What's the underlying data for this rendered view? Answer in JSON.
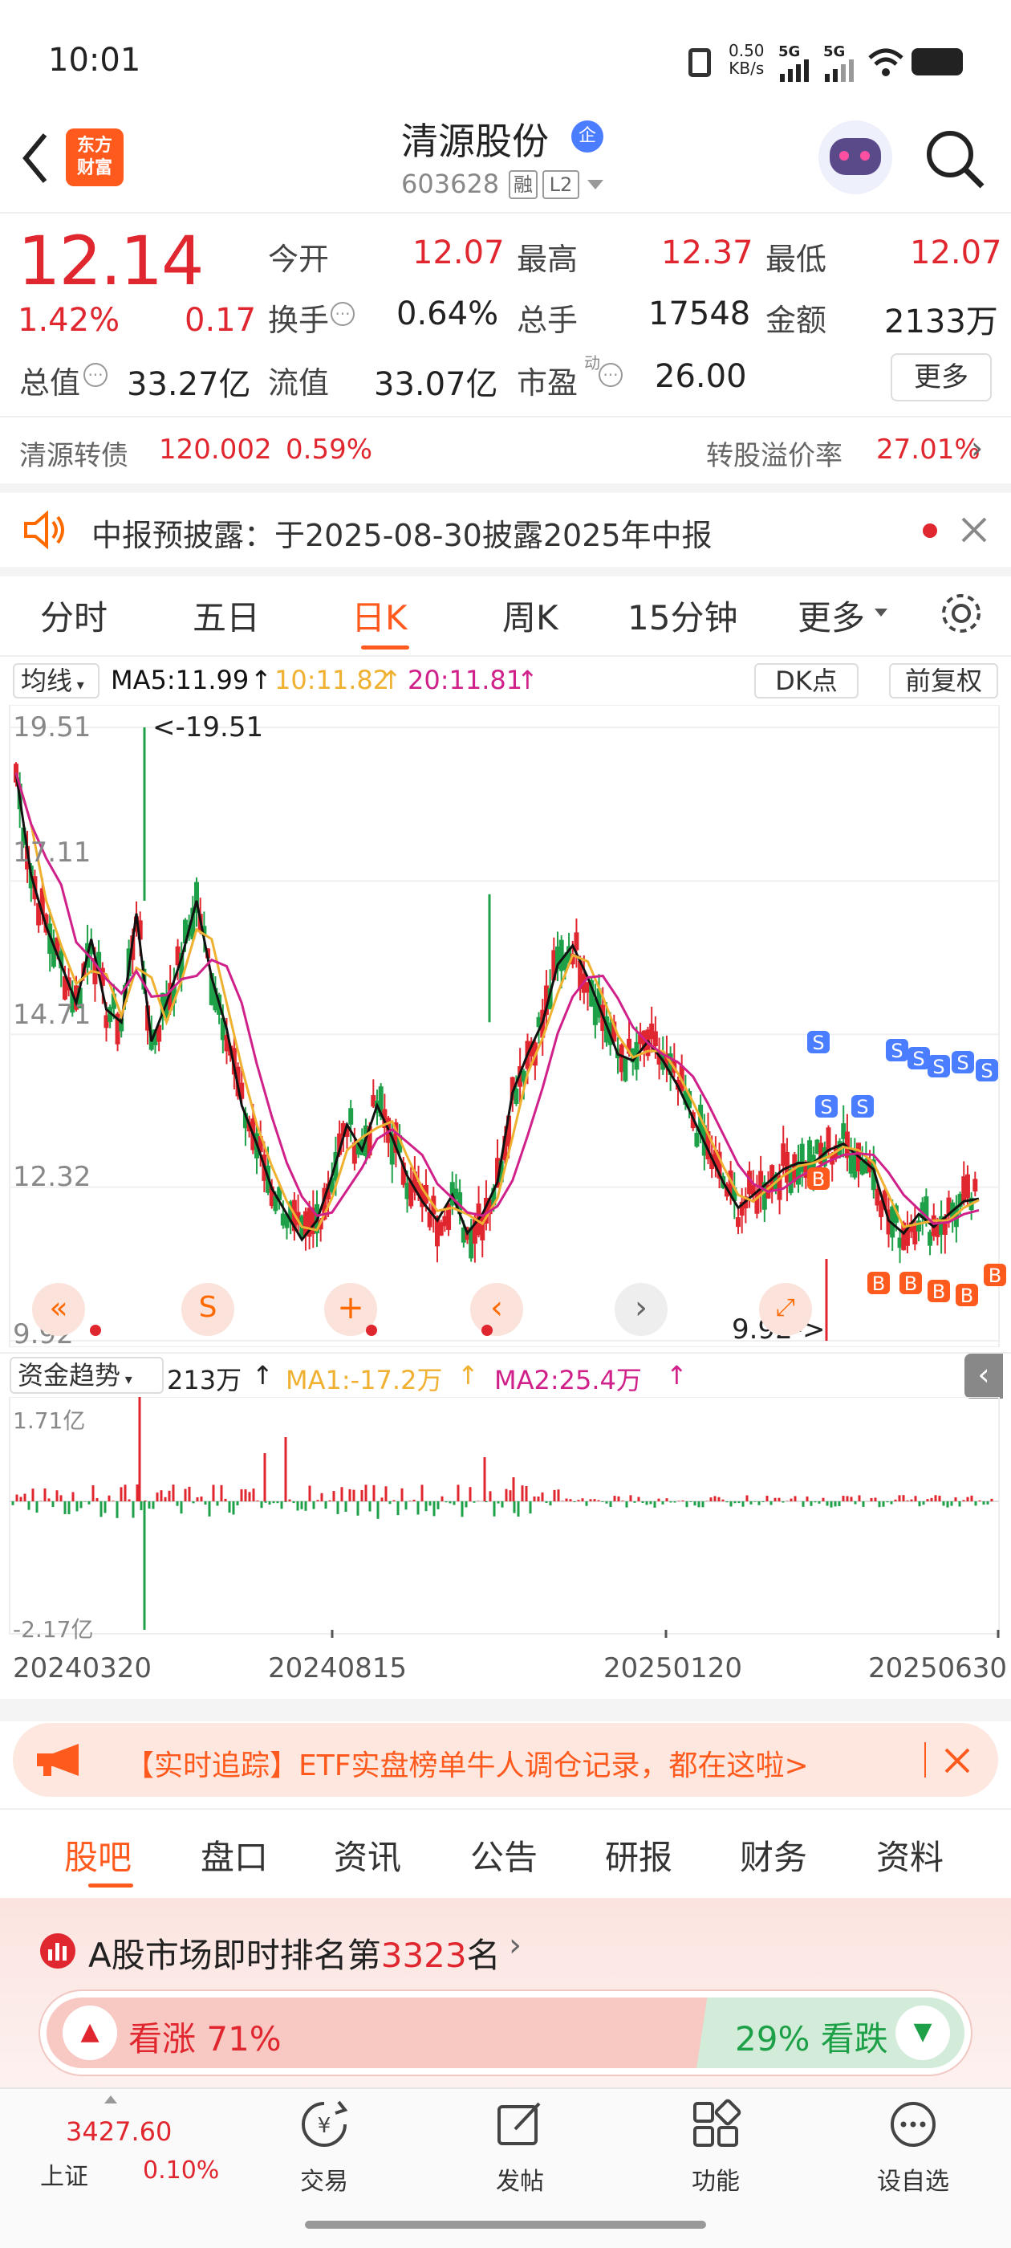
{
  "status": {
    "time": "10:01",
    "net_speed": "0.50",
    "net_unit": "KB/s",
    "sig1": "5G",
    "sig2": "5G"
  },
  "header": {
    "title": "清源股份",
    "title_badge": "企",
    "code": "603628",
    "rong": "融",
    "level": "L2",
    "logo_line1": "东方",
    "logo_line2": "财富"
  },
  "quote": {
    "price": "12.14",
    "pct": "1.42%",
    "chg": "0.17",
    "fields": [
      {
        "label": "今开",
        "value": "12.07",
        "color": "#e0262e"
      },
      {
        "label": "最高",
        "value": "12.37",
        "color": "#e0262e"
      },
      {
        "label": "最低",
        "value": "12.07",
        "color": "#e0262e"
      },
      {
        "label": "换手",
        "value": "0.64%",
        "color": "#222"
      },
      {
        "label": "总手",
        "value": "17548",
        "color": "#222"
      },
      {
        "label": "金额",
        "value": "2133万",
        "color": "#222"
      },
      {
        "label": "总值",
        "value": "33.27亿",
        "color": "#222"
      },
      {
        "label": "流值",
        "value": "33.07亿",
        "color": "#222"
      },
      {
        "label": "市盈",
        "value": "26.00",
        "color": "#222"
      }
    ],
    "pe_sup": "动",
    "more": "更多"
  },
  "bond": {
    "name": "清源转债",
    "price": "120.002",
    "pct": "0.59%",
    "premium_label": "转股溢价率",
    "premium": "27.01%"
  },
  "notice": {
    "text": "中报预披露：于2025-08-30披露2025年中报"
  },
  "chart_tabs": [
    "分时",
    "五日",
    "日K",
    "周K",
    "15分钟",
    "更多"
  ],
  "active_chart_tab": 2,
  "ma_bar": {
    "toggle": "均线",
    "ma5": "MA5:11.99",
    "ma10": "10:11.82",
    "ma20": "20:11.81",
    "dk": "DK点",
    "fq": "前复权"
  },
  "kline_labels": {
    "max": "<-19.51",
    "min": "9.92->"
  },
  "capital_bar": {
    "toggle": "资金趋势",
    "value": "213万",
    "ma1": "MA1:-17.2万",
    "ma2": "MA2:25.4万"
  },
  "dates": [
    "20240320",
    "20240815",
    "20250120",
    "20250630"
  ],
  "ad": {
    "text": "【实时追踪】ETF实盘榜单牛人调仓记录，都在这啦>"
  },
  "bottom_tabs": [
    "股吧",
    "盘口",
    "资讯",
    "公告",
    "研报",
    "财务",
    "资料"
  ],
  "ranking": {
    "prefix": "A股市场即时排名第",
    "rank": "3323",
    "suffix": "名"
  },
  "sentiment": {
    "bull": "看涨 71%",
    "bear": "29% 看跌"
  },
  "nav": {
    "index_value": "3427.60",
    "index_name": "上证",
    "index_pct": "0.10%",
    "items": [
      "交易",
      "发帖",
      "功能",
      "设自选"
    ]
  },
  "colors": {
    "up": "#e0262e",
    "down": "#1ea048",
    "accent": "#ff6a00",
    "ma5": "#111111",
    "ma10": "#f0b030",
    "ma20": "#d0208a"
  },
  "chart_data": {
    "type": "candlestick",
    "x_range": [
      "20240320",
      "20250630"
    ],
    "y_ticks": [
      19.51,
      17.11,
      14.71,
      12.32,
      9.92
    ],
    "ylim": [
      9.92,
      19.51
    ],
    "series_close": [
      18.8,
      17.2,
      16.4,
      15.8,
      15.2,
      16.2,
      15.1,
      14.9,
      16.6,
      14.6,
      15.2,
      15.9,
      16.8,
      15.6,
      14.8,
      13.6,
      13.0,
      12.3,
      11.9,
      11.5,
      11.8,
      12.5,
      13.3,
      12.9,
      13.6,
      13.1,
      12.5,
      12.1,
      11.8,
      12.2,
      11.6,
      11.9,
      12.4,
      13.8,
      14.4,
      14.9,
      15.8,
      16.1,
      15.6,
      15.0,
      14.4,
      14.3,
      14.6,
      14.3,
      13.9,
      13.4,
      12.9,
      12.4,
      12.0,
      12.2,
      12.4,
      12.6,
      12.7,
      12.7,
      12.9,
      13.0,
      12.8,
      12.6,
      11.8,
      11.6,
      11.9,
      11.7,
      11.9,
      12.1,
      12.14
    ],
    "ma_values": {
      "ma5": 11.99,
      "ma10": 11.82,
      "ma20": 11.81
    },
    "capital_ylim": [
      "-2.17亿",
      "1.71亿"
    ]
  }
}
